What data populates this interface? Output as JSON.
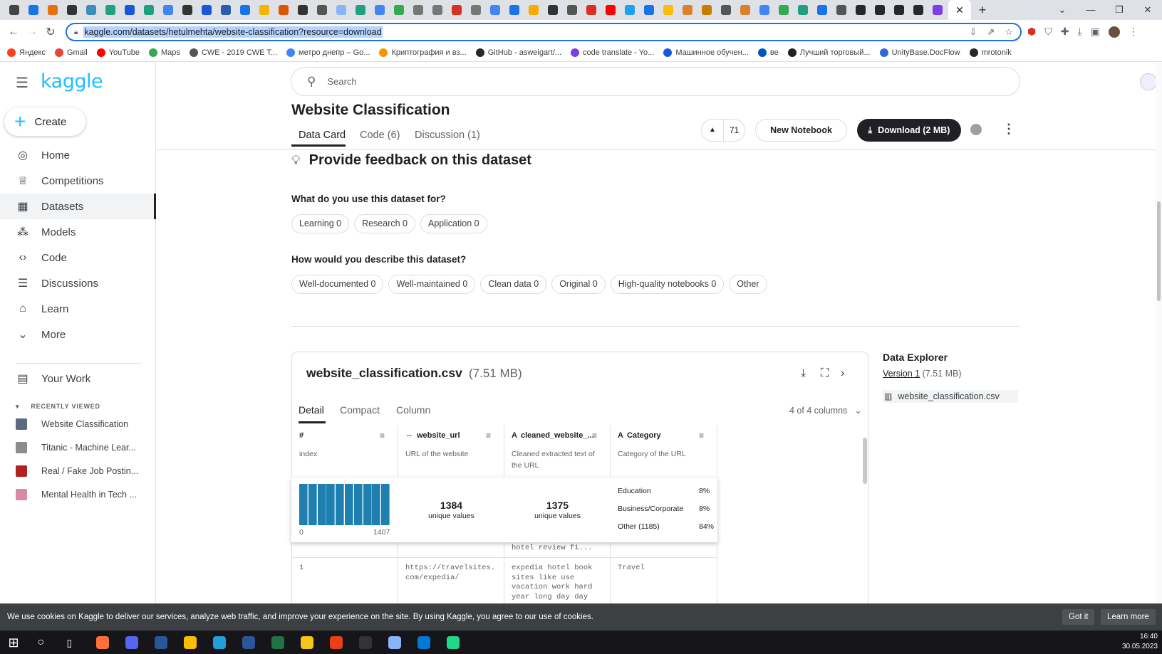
{
  "browser": {
    "url": "kaggle.com/datasets/hetulmehta/website-classification?resource=download",
    "close_glyph": "✕",
    "new_tab_glyph": "+",
    "bookmarks": [
      {
        "label": "Яндекс",
        "color": "#fc3f1d"
      },
      {
        "label": "Gmail",
        "color": "#ea4335"
      },
      {
        "label": "YouTube",
        "color": "#ff0000"
      },
      {
        "label": "Maps",
        "color": "#34a853"
      },
      {
        "label": "CWE - 2019 CWE T...",
        "color": "#555555"
      },
      {
        "label": "метро днепр – Go...",
        "color": "#4285f4"
      },
      {
        "label": "Криптография и вз...",
        "color": "#f29900"
      },
      {
        "label": "GitHub - asweigart/...",
        "color": "#24292e"
      },
      {
        "label": "code translate - Yo...",
        "color": "#7b3fe4"
      },
      {
        "label": "Машинное обучен...",
        "color": "#1a56db"
      },
      {
        "label": "ве",
        "color": "#0057b7"
      },
      {
        "label": "Лучший торговый...",
        "color": "#222222"
      },
      {
        "label": "UnityBase.DocFlow",
        "color": "#3367d6"
      },
      {
        "label": "mrotonik",
        "color": "#24292e"
      }
    ]
  },
  "sidebar": {
    "logo": "kaggle",
    "create_label": "Create",
    "items": [
      {
        "label": "Home",
        "icon": "compass-icon",
        "glyph": "◎"
      },
      {
        "label": "Competitions",
        "icon": "trophy-icon",
        "glyph": "♕"
      },
      {
        "label": "Datasets",
        "icon": "table-icon",
        "glyph": "▦"
      },
      {
        "label": "Models",
        "icon": "models-icon",
        "glyph": "⁂"
      },
      {
        "label": "Code",
        "icon": "code-icon",
        "glyph": "‹›"
      },
      {
        "label": "Discussions",
        "icon": "discussion-icon",
        "glyph": "☰"
      },
      {
        "label": "Learn",
        "icon": "learn-icon",
        "glyph": "⌂"
      },
      {
        "label": "More",
        "icon": "chevron-down-icon",
        "glyph": "⌄"
      }
    ],
    "your_work": "Your Work",
    "recently_viewed_heading": "RECENTLY VIEWED",
    "recent": [
      {
        "label": "Website Classification",
        "color": "#5a6b7d"
      },
      {
        "label": "Titanic - Machine Lear...",
        "color": "#8c8c8c"
      },
      {
        "label": "Real / Fake Job Postin...",
        "color": "#b22222"
      },
      {
        "label": "Mental Health in Tech ...",
        "color": "#d98aa5"
      }
    ]
  },
  "header": {
    "search_placeholder": "Search",
    "title": "Website Classification",
    "tabs": [
      "Data Card",
      "Code (6)",
      "Discussion (1)"
    ],
    "votes": "71",
    "new_notebook": "New Notebook",
    "download": "Download (2 MB)"
  },
  "feedback": {
    "title": "Provide feedback on this dataset",
    "q1": "What do you use this dataset for?",
    "q1_chips": [
      "Learning 0",
      "Research 0",
      "Application 0"
    ],
    "q2": "How would you describe this dataset?",
    "q2_chips": [
      "Well-documented 0",
      "Well-maintained 0",
      "Clean data 0",
      "Original 0",
      "High-quality notebooks 0",
      "Other"
    ]
  },
  "csv": {
    "name": "website_classification.csv",
    "size": "(7.51 MB)",
    "tabs": [
      "Detail",
      "Compact",
      "Column"
    ],
    "column_count": "4 of 4 columns",
    "columns": [
      {
        "type": "#",
        "name": "",
        "desc": "index"
      },
      {
        "type": "⇔",
        "name": "website_url",
        "desc": "URL of the website"
      },
      {
        "type": "A",
        "name": "cleaned_website_...",
        "desc": "Cleaned extracted text of the URL"
      },
      {
        "type": "A",
        "name": "Category",
        "desc": "Category of the URL"
      }
    ],
    "hist_min": "0",
    "hist_max": "1407",
    "url_unique": "1384",
    "text_unique": "1375",
    "unique_label": "unique values",
    "categories": [
      {
        "name": "Education",
        "pct": "8%"
      },
      {
        "name": "Business/Corporate",
        "pct": "8%"
      },
      {
        "name": "Other (1185)",
        "pct": "84%"
      }
    ],
    "prev_row_text": "hotel review fi...",
    "row1": {
      "index": "1",
      "url": "https://travelsites.\ncom/expedia/",
      "text": "expedia hotel book\nsites like use\nvacation work hard\nyear long day day",
      "category": "Travel"
    }
  },
  "explorer": {
    "title": "Data Explorer",
    "version_link": "Version 1",
    "version_size": "(7.51 MB)",
    "file": "website_classification.csv"
  },
  "cookie": {
    "text": "We use cookies on Kaggle to deliver our services, analyze web traffic, and improve your experience on the site. By using Kaggle, you agree to our use of cookies.",
    "got_it": "Got it",
    "learn_more": "Learn more"
  },
  "taskbar": {
    "time": "16:40",
    "date": "30.05.2023"
  }
}
